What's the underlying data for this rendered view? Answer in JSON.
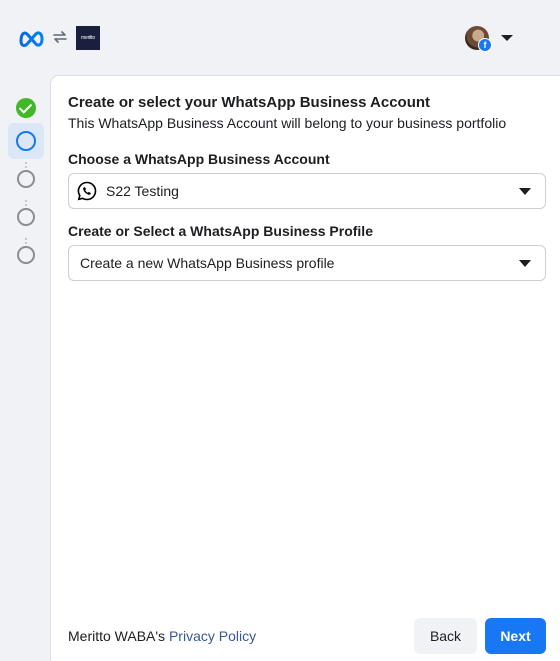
{
  "header": {
    "meta_logo_icon": "meta-infinity-logo-icon",
    "sync_icon": "sync-arrows-icon",
    "brand_logo_text": "meritto",
    "avatar_badge_icon": "facebook-badge-icon",
    "avatar_badge_text": "f",
    "account_menu_icon": "caret-down-icon"
  },
  "stepper": {
    "steps": [
      {
        "state": "done"
      },
      {
        "state": "active"
      },
      {
        "state": "pending"
      },
      {
        "state": "pending"
      },
      {
        "state": "pending"
      }
    ],
    "done_color": "#42b72a",
    "active_color": "#1877f2"
  },
  "panel": {
    "title": "Create or select your WhatsApp Business Account",
    "subtitle": "This WhatsApp Business Account will belong to your business portfolio",
    "account_field": {
      "label": "Choose a WhatsApp Business Account",
      "value": "S22 Testing",
      "icon": "whatsapp-icon"
    },
    "profile_field": {
      "label": "Create or Select a WhatsApp Business Profile",
      "value": "Create a new WhatsApp Business profile"
    }
  },
  "footer": {
    "prefix": "Meritto WABA's ",
    "privacy_link": "Privacy Policy",
    "back_label": "Back",
    "next_label": "Next"
  },
  "colors": {
    "primary": "#1877f2",
    "link": "#385898",
    "background": "#f0f2f5"
  }
}
